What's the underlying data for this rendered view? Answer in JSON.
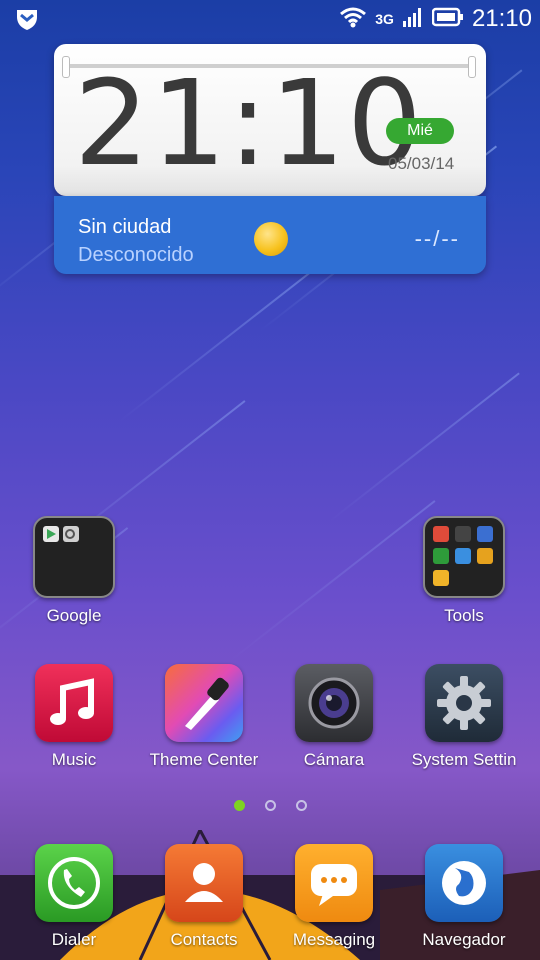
{
  "status_bar": {
    "network_label": "3G",
    "time": "21:10",
    "icons": [
      "shield-icon",
      "wifi-icon",
      "signal-icon",
      "battery-icon"
    ]
  },
  "clock_widget": {
    "time": "21:10",
    "day": "Mié",
    "date": "05/03/14",
    "accent": "#36a832"
  },
  "weather_widget": {
    "city": "Sin ciudad",
    "status": "Desconocido",
    "temperature": "--/--",
    "icon": "sun-icon",
    "accent": "#2f6fd4"
  },
  "folders": [
    {
      "label": "Google",
      "icon": "folder-icon"
    },
    {
      "label": "Tools",
      "icon": "folder-icon"
    }
  ],
  "apps": [
    {
      "label": "Music",
      "icon": "music-icon"
    },
    {
      "label": "Theme Center",
      "icon": "theme-icon"
    },
    {
      "label": "Cámara",
      "icon": "camera-icon"
    },
    {
      "label": "System Settin",
      "icon": "gear-icon"
    }
  ],
  "pages": {
    "count": 3,
    "active": 1
  },
  "dock": [
    {
      "label": "Dialer",
      "icon": "phone-icon"
    },
    {
      "label": "Contacts",
      "icon": "contacts-icon"
    },
    {
      "label": "Messaging",
      "icon": "messaging-icon"
    },
    {
      "label": "Navegador",
      "icon": "globe-icon"
    }
  ]
}
